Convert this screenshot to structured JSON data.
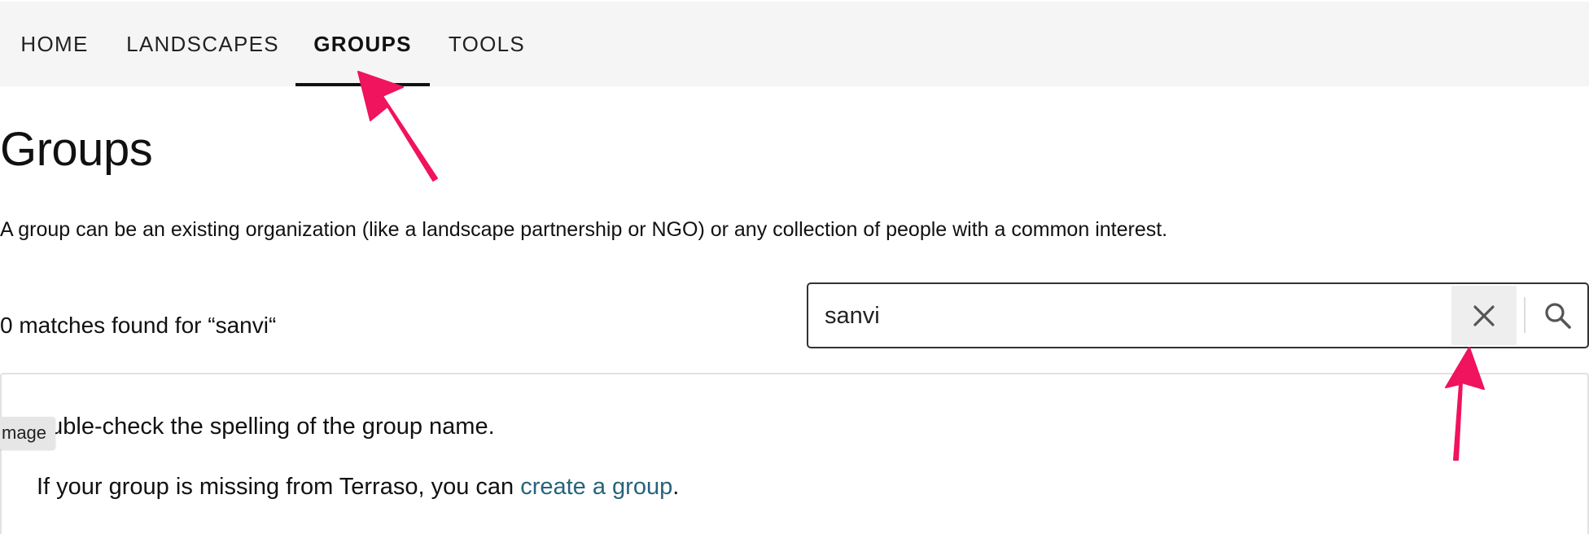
{
  "nav": {
    "items": [
      {
        "label": "HOME"
      },
      {
        "label": "LANDSCAPES"
      },
      {
        "label": "GROUPS"
      },
      {
        "label": "TOOLS"
      }
    ],
    "active": "GROUPS"
  },
  "page": {
    "title": "Groups",
    "description": "A group can be an existing organization (like a landscape partnership or NGO) or any collection of people with a common interest."
  },
  "search": {
    "value": "sanvi",
    "matches_text": "0 matches found for “sanvi“"
  },
  "results": {
    "hint": "ouble-check the spelling of the group name.",
    "missing_prefix": "If your group is missing from Terraso, you can ",
    "create_link": "create a group",
    "missing_suffix": "."
  },
  "tooltip": {
    "text": "mage"
  },
  "colors": {
    "nav_bg": "#f5f5f5",
    "link": "#26637b",
    "annotation_arrow": "#f0135e"
  },
  "icons": [
    "close-icon",
    "search-icon"
  ]
}
